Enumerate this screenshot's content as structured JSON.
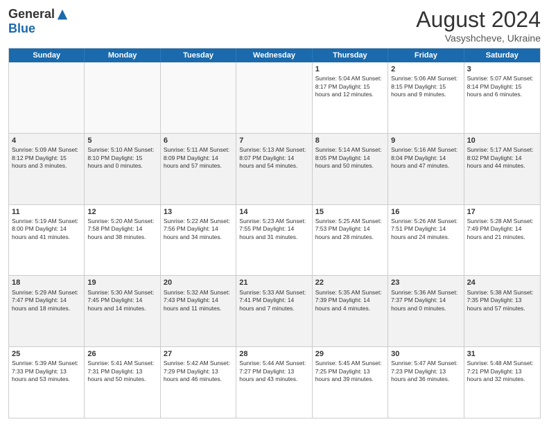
{
  "header": {
    "logo_general": "General",
    "logo_blue": "Blue",
    "month_year": "August 2024",
    "location": "Vasyshcheve, Ukraine"
  },
  "weekdays": [
    "Sunday",
    "Monday",
    "Tuesday",
    "Wednesday",
    "Thursday",
    "Friday",
    "Saturday"
  ],
  "weeks": [
    [
      {
        "day": "",
        "text": "",
        "empty": true
      },
      {
        "day": "",
        "text": "",
        "empty": true
      },
      {
        "day": "",
        "text": "",
        "empty": true
      },
      {
        "day": "",
        "text": "",
        "empty": true
      },
      {
        "day": "1",
        "text": "Sunrise: 5:04 AM\nSunset: 8:17 PM\nDaylight: 15 hours\nand 12 minutes.",
        "empty": false
      },
      {
        "day": "2",
        "text": "Sunrise: 5:06 AM\nSunset: 8:15 PM\nDaylight: 15 hours\nand 9 minutes.",
        "empty": false
      },
      {
        "day": "3",
        "text": "Sunrise: 5:07 AM\nSunset: 8:14 PM\nDaylight: 15 hours\nand 6 minutes.",
        "empty": false
      }
    ],
    [
      {
        "day": "4",
        "text": "Sunrise: 5:09 AM\nSunset: 8:12 PM\nDaylight: 15 hours\nand 3 minutes.",
        "empty": false
      },
      {
        "day": "5",
        "text": "Sunrise: 5:10 AM\nSunset: 8:10 PM\nDaylight: 15 hours\nand 0 minutes.",
        "empty": false
      },
      {
        "day": "6",
        "text": "Sunrise: 5:11 AM\nSunset: 8:09 PM\nDaylight: 14 hours\nand 57 minutes.",
        "empty": false
      },
      {
        "day": "7",
        "text": "Sunrise: 5:13 AM\nSunset: 8:07 PM\nDaylight: 14 hours\nand 54 minutes.",
        "empty": false
      },
      {
        "day": "8",
        "text": "Sunrise: 5:14 AM\nSunset: 8:05 PM\nDaylight: 14 hours\nand 50 minutes.",
        "empty": false
      },
      {
        "day": "9",
        "text": "Sunrise: 5:16 AM\nSunset: 8:04 PM\nDaylight: 14 hours\nand 47 minutes.",
        "empty": false
      },
      {
        "day": "10",
        "text": "Sunrise: 5:17 AM\nSunset: 8:02 PM\nDaylight: 14 hours\nand 44 minutes.",
        "empty": false
      }
    ],
    [
      {
        "day": "11",
        "text": "Sunrise: 5:19 AM\nSunset: 8:00 PM\nDaylight: 14 hours\nand 41 minutes.",
        "empty": false
      },
      {
        "day": "12",
        "text": "Sunrise: 5:20 AM\nSunset: 7:58 PM\nDaylight: 14 hours\nand 38 minutes.",
        "empty": false
      },
      {
        "day": "13",
        "text": "Sunrise: 5:22 AM\nSunset: 7:56 PM\nDaylight: 14 hours\nand 34 minutes.",
        "empty": false
      },
      {
        "day": "14",
        "text": "Sunrise: 5:23 AM\nSunset: 7:55 PM\nDaylight: 14 hours\nand 31 minutes.",
        "empty": false
      },
      {
        "day": "15",
        "text": "Sunrise: 5:25 AM\nSunset: 7:53 PM\nDaylight: 14 hours\nand 28 minutes.",
        "empty": false
      },
      {
        "day": "16",
        "text": "Sunrise: 5:26 AM\nSunset: 7:51 PM\nDaylight: 14 hours\nand 24 minutes.",
        "empty": false
      },
      {
        "day": "17",
        "text": "Sunrise: 5:28 AM\nSunset: 7:49 PM\nDaylight: 14 hours\nand 21 minutes.",
        "empty": false
      }
    ],
    [
      {
        "day": "18",
        "text": "Sunrise: 5:29 AM\nSunset: 7:47 PM\nDaylight: 14 hours\nand 18 minutes.",
        "empty": false
      },
      {
        "day": "19",
        "text": "Sunrise: 5:30 AM\nSunset: 7:45 PM\nDaylight: 14 hours\nand 14 minutes.",
        "empty": false
      },
      {
        "day": "20",
        "text": "Sunrise: 5:32 AM\nSunset: 7:43 PM\nDaylight: 14 hours\nand 11 minutes.",
        "empty": false
      },
      {
        "day": "21",
        "text": "Sunrise: 5:33 AM\nSunset: 7:41 PM\nDaylight: 14 hours\nand 7 minutes.",
        "empty": false
      },
      {
        "day": "22",
        "text": "Sunrise: 5:35 AM\nSunset: 7:39 PM\nDaylight: 14 hours\nand 4 minutes.",
        "empty": false
      },
      {
        "day": "23",
        "text": "Sunrise: 5:36 AM\nSunset: 7:37 PM\nDaylight: 14 hours\nand 0 minutes.",
        "empty": false
      },
      {
        "day": "24",
        "text": "Sunrise: 5:38 AM\nSunset: 7:35 PM\nDaylight: 13 hours\nand 57 minutes.",
        "empty": false
      }
    ],
    [
      {
        "day": "25",
        "text": "Sunrise: 5:39 AM\nSunset: 7:33 PM\nDaylight: 13 hours\nand 53 minutes.",
        "empty": false
      },
      {
        "day": "26",
        "text": "Sunrise: 5:41 AM\nSunset: 7:31 PM\nDaylight: 13 hours\nand 50 minutes.",
        "empty": false
      },
      {
        "day": "27",
        "text": "Sunrise: 5:42 AM\nSunset: 7:29 PM\nDaylight: 13 hours\nand 46 minutes.",
        "empty": false
      },
      {
        "day": "28",
        "text": "Sunrise: 5:44 AM\nSunset: 7:27 PM\nDaylight: 13 hours\nand 43 minutes.",
        "empty": false
      },
      {
        "day": "29",
        "text": "Sunrise: 5:45 AM\nSunset: 7:25 PM\nDaylight: 13 hours\nand 39 minutes.",
        "empty": false
      },
      {
        "day": "30",
        "text": "Sunrise: 5:47 AM\nSunset: 7:23 PM\nDaylight: 13 hours\nand 36 minutes.",
        "empty": false
      },
      {
        "day": "31",
        "text": "Sunrise: 5:48 AM\nSunset: 7:21 PM\nDaylight: 13 hours\nand 32 minutes.",
        "empty": false
      }
    ]
  ]
}
